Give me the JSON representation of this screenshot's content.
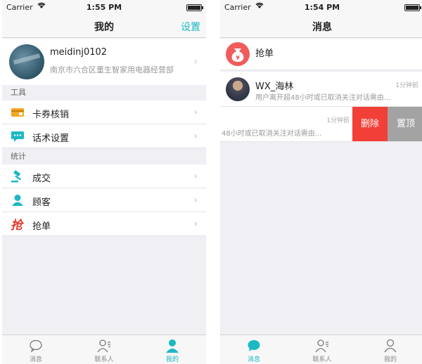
{
  "colors": {
    "accent": "#1cb8c3",
    "delete": "#f23f38",
    "pin": "#a3a3a3",
    "grab": "#f05c5c"
  },
  "left": {
    "status": {
      "carrier": "Carrier",
      "time": "1:55 PM"
    },
    "nav": {
      "title": "我的",
      "right": "设置"
    },
    "profile": {
      "name": "meidinj0102",
      "company": "南京市六合区董生智家用电器经营部"
    },
    "sections": [
      {
        "header": "工具",
        "items": [
          {
            "label": "卡券核销",
            "icon": "voucher-icon"
          },
          {
            "label": "话术设置",
            "icon": "chat-bubble-icon"
          }
        ]
      },
      {
        "header": "统计",
        "items": [
          {
            "label": "成交",
            "icon": "gavel-icon"
          },
          {
            "label": "顾客",
            "icon": "user-icon"
          },
          {
            "label": "抢单",
            "icon": "grab-order-icon"
          }
        ]
      }
    ],
    "tabs": [
      {
        "label": "消息",
        "icon": "message-icon"
      },
      {
        "label": "联系人",
        "icon": "contacts-icon"
      },
      {
        "label": "我的",
        "icon": "profile-icon",
        "active": true
      }
    ]
  },
  "right": {
    "status": {
      "carrier": "Carrier",
      "time": "1:54 PM"
    },
    "nav": {
      "title": "消息"
    },
    "grab": {
      "label": "抢单",
      "icon": "money-bag-icon"
    },
    "messages": [
      {
        "name": "WX_海林",
        "time": "1分钟前",
        "preview": "用户离开超48小时或已取消关注对话需由..."
      },
      {
        "name": "",
        "time": "1分钟前",
        "preview": "48小时或已取消关注对话需由..."
      }
    ],
    "swipe_actions": {
      "delete": "删除",
      "pin": "置顶"
    },
    "tabs": [
      {
        "label": "消息",
        "icon": "message-icon",
        "active": true
      },
      {
        "label": "联系人",
        "icon": "contacts-icon"
      },
      {
        "label": "我的",
        "icon": "profile-icon"
      }
    ]
  }
}
